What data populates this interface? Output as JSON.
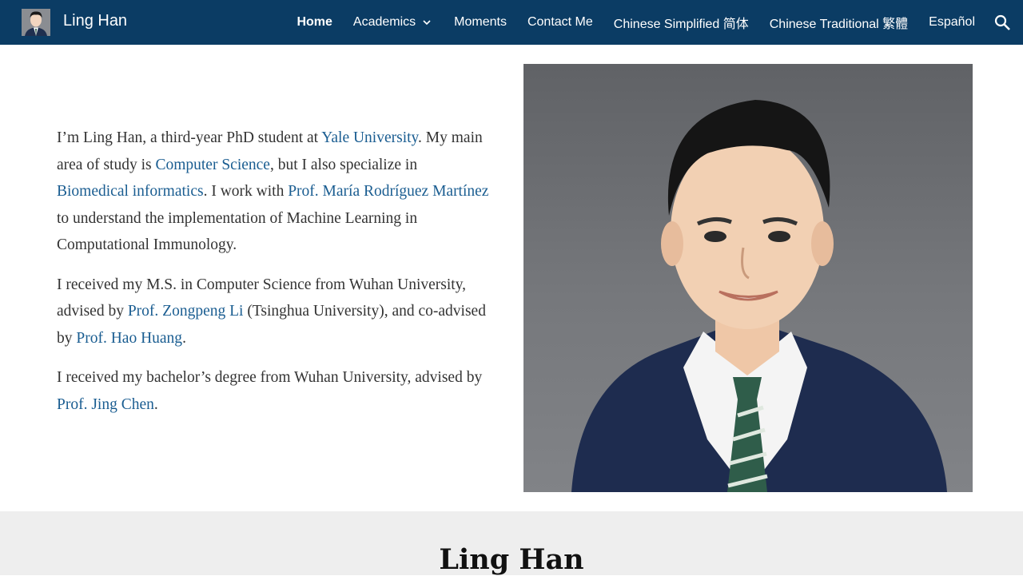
{
  "header": {
    "site_title": "Ling Han",
    "nav": [
      {
        "label": "Home",
        "active": true
      },
      {
        "label": "Academics",
        "has_dropdown": true
      },
      {
        "label": "Moments"
      },
      {
        "label": "Contact Me"
      },
      {
        "label": "Chinese Simplified 简体"
      },
      {
        "label": "Chinese Traditional 繁體"
      },
      {
        "label": "Español"
      }
    ],
    "icons": {
      "avatar": "profile-avatar",
      "dropdown": "chevron-down-icon",
      "search": "search-icon"
    },
    "bg_color": "#0b3c64"
  },
  "intro": {
    "p1": {
      "t1": "I’m Ling Han, a third-year PhD student at ",
      "l1": "Yale University",
      "t2": ". My main area of study is ",
      "l2": "Computer Science",
      "t3": ", but I also specialize in ",
      "l3": "Biomedical informatics",
      "t4": ". I work with ",
      "l4": "Prof. María Rodríguez Martínez",
      "t5": " to understand the implementation of Machine Learning in Computational Immunology."
    },
    "p2": {
      "t1": "I received my M.S. in Computer Science from Wuhan University, advised by ",
      "l1": "Prof. Zongpeng Li",
      "t2": " (Tsinghua University), and co-advised by ",
      "l2": "Prof. Hao Huang",
      "t3": "."
    },
    "p3": {
      "t1": "I received my bachelor’s degree from Wuhan University, advised by ",
      "l1": "Prof. Jing Chen",
      "t2": "."
    },
    "link_color": "#1a5d91"
  },
  "footer": {
    "title": "Ling Han"
  }
}
